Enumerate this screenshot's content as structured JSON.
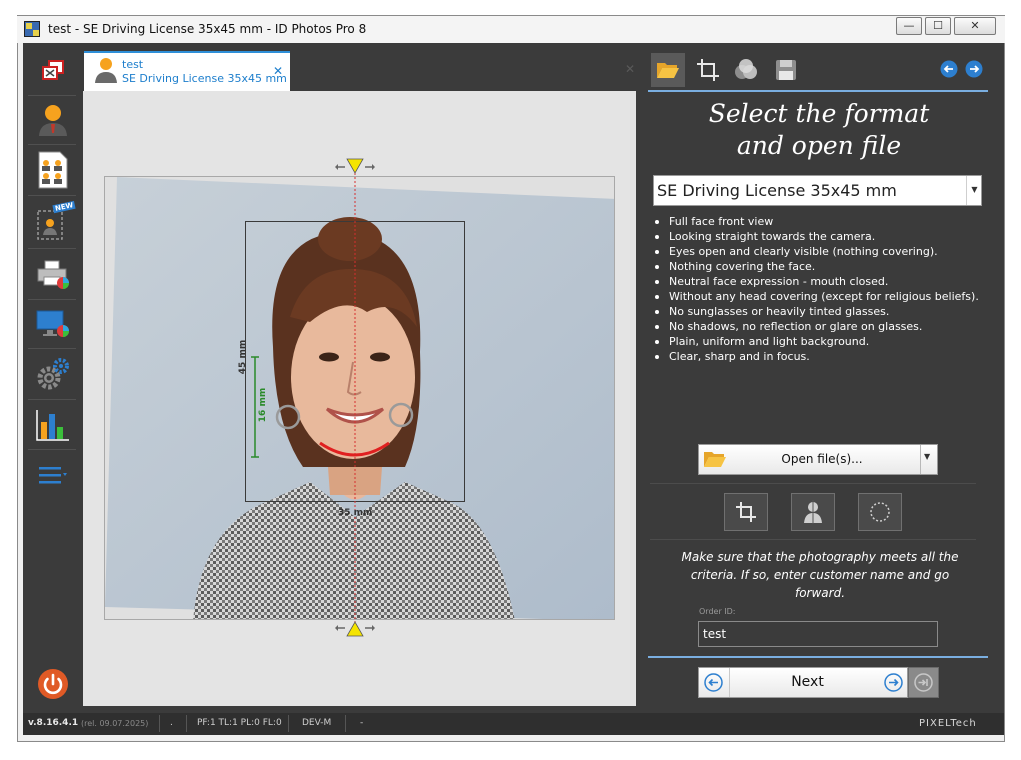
{
  "window": {
    "title": "test - SE Driving License 35x45 mm - ID Photos Pro 8",
    "minimize": "—",
    "maximize": "☐",
    "close": "✕"
  },
  "sidebar": {
    "items": [
      {
        "name": "photo-print-icon"
      },
      {
        "name": "person-icon"
      },
      {
        "name": "passport-sheet-icon"
      },
      {
        "name": "new-template-icon",
        "badge": "NEW"
      },
      {
        "name": "printer-icon"
      },
      {
        "name": "monitor-icon"
      },
      {
        "name": "gear-icon"
      },
      {
        "name": "chart-icon"
      },
      {
        "name": "menu-icon"
      }
    ],
    "power": "power-icon"
  },
  "tab": {
    "name": "test",
    "format": "SE Driving License 35x45 mm",
    "close": "✕",
    "tabbar_close": "✕"
  },
  "canvas": {
    "dim_height_outer": "45 mm",
    "dim_height_inner": "16 mm",
    "dim_width": "35 mm"
  },
  "panel": {
    "tools": [
      "folder-icon",
      "crop-icon",
      "color-icon",
      "save-icon"
    ],
    "title_line1": "Select the format",
    "title_line2": "and open file",
    "selected_format": "SE Driving License 35x45 mm",
    "requirements": [
      "Full face front view",
      "Looking straight towards the camera.",
      "Eyes open and clearly visible (nothing covering).",
      "Nothing covering the face.",
      "Neutral face expression - mouth closed.",
      "Without any head covering (except for religious beliefs).",
      "No sunglasses or heavily tinted glasses.",
      "No shadows, no reflection or glare on glasses.",
      "Plain, uniform and light background.",
      "Clear, sharp and in focus."
    ],
    "open_button": "Open file(s)...",
    "instructions": "Make sure that the photography meets all the criteria. If so, enter customer name and go forward.",
    "order_label": "Order ID:",
    "order_value": "test",
    "next_button": "Next"
  },
  "status": {
    "version": "v.8.16.4.1",
    "release": "(rel. 09.07.2025)",
    "dot": ".",
    "flags": "PF:1 TL:1 PL:0 FL:0",
    "mode": "DEV-M",
    "dash": "-",
    "brand": "PIXELTech"
  },
  "colors": {
    "accent": "#2f8fd8",
    "panel_bg": "#3b3b3b",
    "power": "#e05a26",
    "guide": "#d62f2f",
    "measure": "#2a8a2a",
    "marker": "#f5e400"
  }
}
